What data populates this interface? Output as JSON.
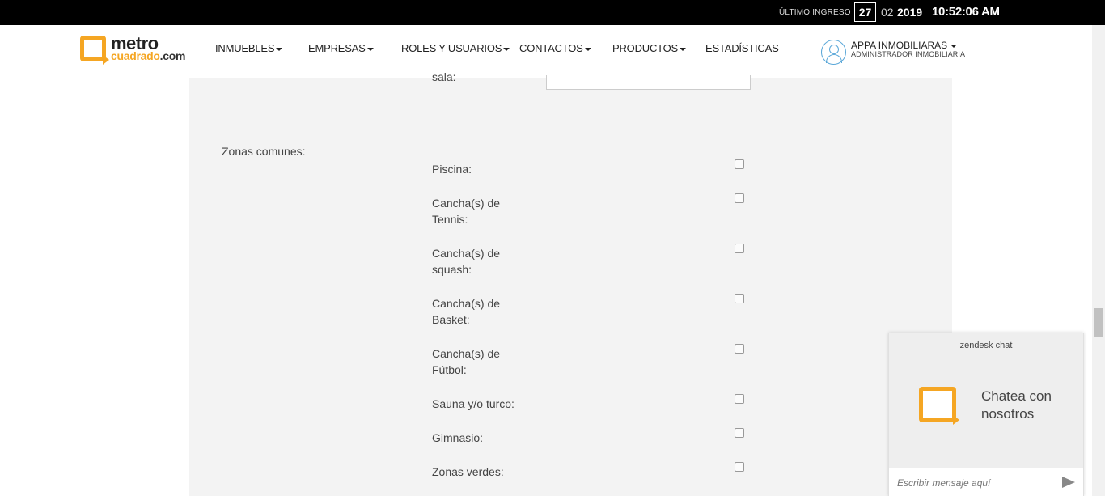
{
  "topbar": {
    "last_login_label": "ÚLTIMO INGRESO",
    "day": "27",
    "month": "02",
    "year": "2019",
    "time": "10:52:06 AM"
  },
  "logo": {
    "line1": "metro",
    "line2a": "cuadrado",
    "line2b": ".com"
  },
  "nav": {
    "items": [
      {
        "label": "INMUEBLES"
      },
      {
        "label": "EMPRESAS"
      },
      {
        "label": "ROLES Y USUARIOS"
      },
      {
        "label": "CONTACTOS"
      },
      {
        "label": "PRODUCTOS"
      },
      {
        "label": "ESTADÍSTICAS"
      }
    ]
  },
  "user": {
    "name": "APPA INMOBILIARAS",
    "role": "ADMINISTRADOR INMOBILIARIA"
  },
  "form": {
    "sala_label": "sala:",
    "zonas_label": "Zonas comunes:",
    "amenities": [
      {
        "label": "Piscina:",
        "checked": false
      },
      {
        "label": "Cancha(s) de Tennis:",
        "checked": false
      },
      {
        "label": "Cancha(s) de squash:",
        "checked": false
      },
      {
        "label": "Cancha(s) de Basket:",
        "checked": false
      },
      {
        "label": "Cancha(s) de Fútbol:",
        "checked": false
      },
      {
        "label": "Sauna y/o turco:",
        "checked": false
      },
      {
        "label": "Gimnasio:",
        "checked": false
      },
      {
        "label": "Zonas verdes:",
        "checked": false
      }
    ]
  },
  "chat": {
    "brand": "zendesk chat",
    "cta": "Chatea con nosotros",
    "placeholder": "Escribir mensaje aquí"
  },
  "colors": {
    "accent": "#f5a623",
    "topbar": "#000000",
    "panel": "#f3f3f3"
  }
}
